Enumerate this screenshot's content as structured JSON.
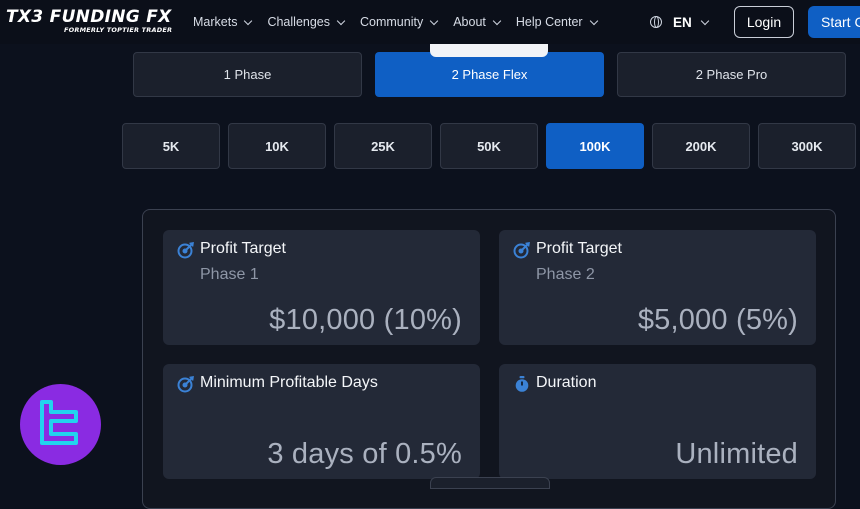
{
  "brand": {
    "name": "TX3 FUNDING FX",
    "tagline": "FORMERLY TOPTIER TRADER"
  },
  "nav": {
    "items": [
      {
        "label": "Markets"
      },
      {
        "label": "Challenges"
      },
      {
        "label": "Community"
      },
      {
        "label": "About"
      },
      {
        "label": "Help Center"
      }
    ],
    "language": "EN",
    "login_label": "Login",
    "start_label": "Start C"
  },
  "phases": [
    {
      "label": "1 Phase",
      "selected": false
    },
    {
      "label": "2 Phase Flex",
      "selected": true
    },
    {
      "label": "2 Phase Pro",
      "selected": false
    }
  ],
  "account_sizes": [
    {
      "label": "5K",
      "selected": false
    },
    {
      "label": "10K",
      "selected": false
    },
    {
      "label": "25K",
      "selected": false
    },
    {
      "label": "50K",
      "selected": false
    },
    {
      "label": "100K",
      "selected": true
    },
    {
      "label": "200K",
      "selected": false
    },
    {
      "label": "300K",
      "selected": false
    }
  ],
  "metrics": [
    {
      "icon": "target-icon",
      "title": "Profit Target",
      "subtitle": "Phase 1",
      "value": "$10,000 (10%)"
    },
    {
      "icon": "target-icon",
      "title": "Profit Target",
      "subtitle": "Phase 2",
      "value": "$5,000 (5%)"
    },
    {
      "icon": "target-icon",
      "title": "Minimum Profitable Days",
      "subtitle": "",
      "value": "3 days of 0.5%"
    },
    {
      "icon": "stopwatch-icon",
      "title": "Duration",
      "subtitle": "",
      "value": "Unlimited"
    }
  ],
  "colors": {
    "accent": "#0f5fc4",
    "background": "#0c111d",
    "card": "#232937",
    "icon": "#3b82d6",
    "watermark": "#8a2be2",
    "watermark_glyph": "#22d3ee"
  }
}
